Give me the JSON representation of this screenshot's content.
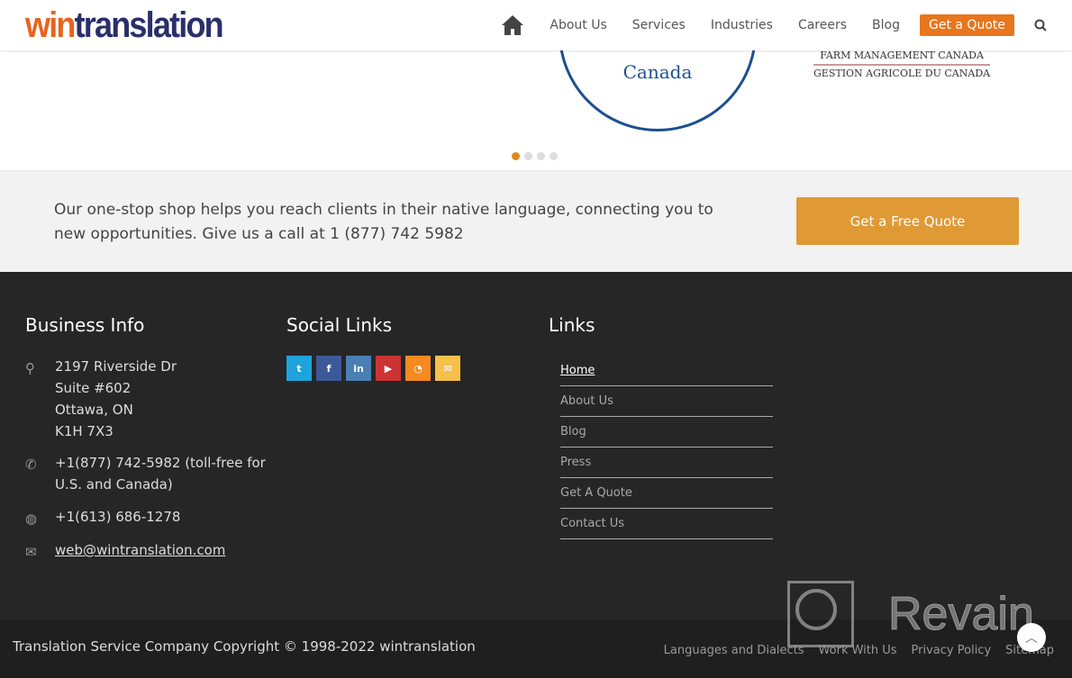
{
  "header": {
    "logo_a": "win",
    "logo_b": "translation",
    "nav": [
      "About Us",
      "Services",
      "Industries",
      "Careers",
      "Blog"
    ],
    "quote": "Get a Quote",
    "home_icon": "home-icon",
    "search_icon": "search-icon"
  },
  "slider": {
    "canada": "Canada",
    "farm1": "FARM MANAGEMENT CANADA",
    "farm2": "GESTION AGRICOLE DU CANADA",
    "active_dot": 1,
    "dot_count": 4
  },
  "cta": {
    "text": "Our one-stop shop helps you reach clients in their native language, connecting you to new opportunities. Give us a call at 1 (877) 742 5982",
    "button": "Get a Free Quote"
  },
  "footer": {
    "business": {
      "title": "Business Info",
      "address": [
        "2197 Riverside Dr",
        "Suite #602",
        "Ottawa, ON",
        "K1H 7X3"
      ],
      "phone": "+1(877) 742-5982 (toll-free for U.S. and Canada)",
      "phone2": "+1(613) 686-1278",
      "email": "web@wintranslation.com"
    },
    "social": {
      "title": "Social Links",
      "items": [
        {
          "icon": "twitter-icon",
          "glyph": "t",
          "color": "#1fa3dc"
        },
        {
          "icon": "facebook-icon",
          "glyph": "f",
          "color": "#3b5998"
        },
        {
          "icon": "linkedin-icon",
          "glyph": "in",
          "color": "#4a7fb5"
        },
        {
          "icon": "youtube-icon",
          "glyph": "▶",
          "color": "#cc3333"
        },
        {
          "icon": "rss-icon",
          "glyph": "◔",
          "color": "#f58a1f"
        },
        {
          "icon": "email-icon",
          "glyph": "✉",
          "color": "#f7c04a"
        }
      ]
    },
    "links": {
      "title": "Links",
      "items": [
        "Home",
        "About Us",
        "Blog",
        "Press",
        "Get A Quote",
        "Contact Us"
      ]
    }
  },
  "bottom": {
    "copyright": "Translation Service Company Copyright © 1998-2022 wintranslation",
    "links": [
      "Languages and Dialects",
      "Work With Us",
      "Privacy Policy",
      "Sitemap"
    ]
  },
  "watermark": "Revain"
}
